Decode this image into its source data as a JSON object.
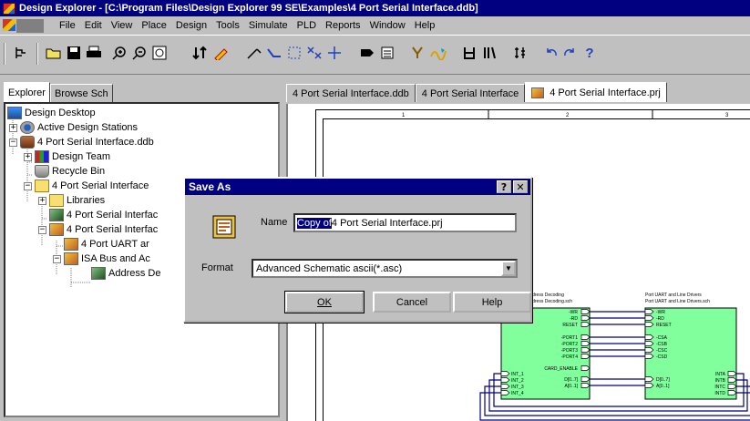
{
  "window": {
    "title": "Design Explorer - [C:\\Program Files\\Design Explorer 99 SE\\Examples\\4 Port Serial Interface.ddb]"
  },
  "menu": [
    "File",
    "Edit",
    "View",
    "Place",
    "Design",
    "Tools",
    "Simulate",
    "PLD",
    "Reports",
    "Window",
    "Help"
  ],
  "toolbar": {
    "icons": [
      "hierarchy-icon",
      "open-icon",
      "save-icon",
      "print-icon",
      "zoom-in-icon",
      "zoom-out-icon",
      "zoom-fit-icon",
      "move-icon",
      "pencil-icon",
      "wire-icon",
      "bus-icon",
      "select-icon",
      "no-erc-icon",
      "crosshair-icon",
      "port-icon",
      "sheet-symbol-icon",
      "probe-icon",
      "waveform-icon",
      "component-icon",
      "library-icon",
      "grid-icon",
      "undo-icon",
      "redo-icon",
      "help-icon"
    ]
  },
  "left_tabs": [
    "Explorer",
    "Browse Sch"
  ],
  "tree": [
    {
      "label": "Design Desktop",
      "icon": "desktop"
    },
    {
      "label": "Active Design Stations",
      "icon": "stations"
    },
    {
      "label": "4 Port Serial Interface.ddb",
      "icon": "db"
    },
    {
      "label": "Design Team",
      "icon": "team"
    },
    {
      "label": "Recycle Bin",
      "icon": "bin"
    },
    {
      "label": "4 Port Serial Interface",
      "icon": "folder"
    },
    {
      "label": "Libraries",
      "icon": "folder"
    },
    {
      "label": "4 Port Serial Interfac",
      "icon": "sch"
    },
    {
      "label": "4 Port Serial Interfac",
      "icon": "prj"
    },
    {
      "label": "4 Port UART ar",
      "icon": "prj"
    },
    {
      "label": "ISA Bus and Ac",
      "icon": "prj"
    },
    {
      "label": "Address De",
      "icon": "sch"
    }
  ],
  "doc_tabs": [
    "4 Port Serial Interface.ddb",
    "4 Port Serial Interface",
    "4 Port Serial Interface.prj"
  ],
  "sheet_labels": {
    "block1_title": "Address Decoding",
    "block1_file": "Address Decoding.sch",
    "block2_title": "Port UART and Line Drivers",
    "block2_file": "Port UART and Line Drivers.sch",
    "pins_left": [
      "-WR",
      "-RD",
      "RESET",
      "-PORT1",
      "-PORT2",
      "-PORT3",
      "-PORT4",
      "CARD_ENABLE",
      "D[0..7]",
      "A[0..1]"
    ],
    "pins_right": [
      "-WR",
      "-RD",
      "RESET",
      "-CSA",
      "-CSB",
      "-CSC",
      "-CSD",
      "D[0..7]",
      "A[0..1]"
    ],
    "ints_left": [
      "INT_1",
      "INT_2",
      "INT_3",
      "INT_4"
    ],
    "ints_right": [
      "INTA",
      "INTB",
      "INTC",
      "INTD"
    ],
    "ruler": [
      "1",
      "2",
      "3"
    ]
  },
  "dialog": {
    "title": "Save As",
    "name_label": "Name",
    "name_selected": "Copy of",
    "name_rest": " 4 Port Serial Interface.prj",
    "format_label": "Format",
    "format_value": "Advanced Schematic ascii(*.asc)",
    "ok": "OK",
    "cancel": "Cancel",
    "help": "Help",
    "help_btn": "?",
    "close_btn": "✕"
  },
  "colors": {
    "title_bg": "#000080",
    "block_fill": "#80ff9c",
    "wire": "#000080"
  }
}
